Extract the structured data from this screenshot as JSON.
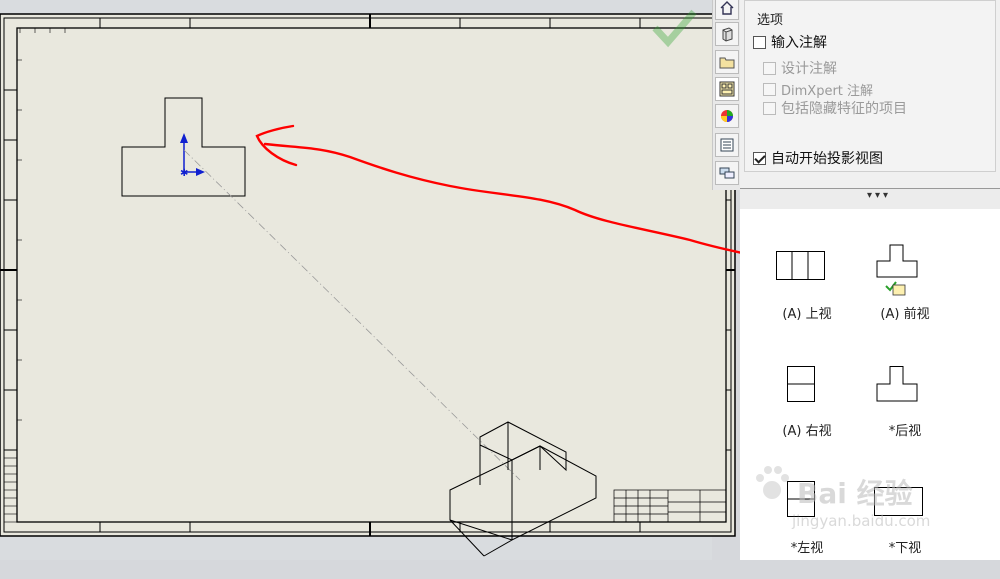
{
  "options_panel": {
    "title": "选项",
    "import_annotations": {
      "label": "输入注解",
      "checked": false
    },
    "design_annotations": {
      "label": "设计注解",
      "checked": false,
      "disabled": true
    },
    "dimxpert_annotations": {
      "label": "DimXpert 注解",
      "checked": false,
      "disabled": true
    },
    "include_hidden": {
      "label": "包括隐藏特征的项目",
      "checked": false,
      "disabled": true
    },
    "auto_projected": {
      "label": "自动开始投影视图",
      "checked": true
    }
  },
  "views": [
    {
      "label": "(A) 上视",
      "id": "top"
    },
    {
      "label": "(A) 前视",
      "id": "front",
      "selected": true
    },
    {
      "label": "(A) 右视",
      "id": "right"
    },
    {
      "label": "*后视",
      "id": "back"
    },
    {
      "label": "*左视",
      "id": "left"
    },
    {
      "label": "*下视",
      "id": "bottom"
    }
  ],
  "toolbar_icons": [
    "home-icon",
    "part-icon",
    "folder-icon",
    "view-palette-icon",
    "appearance-icon",
    "custom-properties-icon",
    "forum-icon"
  ],
  "watermark": {
    "text": "Bai 经验",
    "sub": "jingyan.baidu.com"
  },
  "colors": {
    "sheet": "#e9e8de",
    "annotation_arrow": "#ff0000",
    "axis": "#1020d0"
  }
}
